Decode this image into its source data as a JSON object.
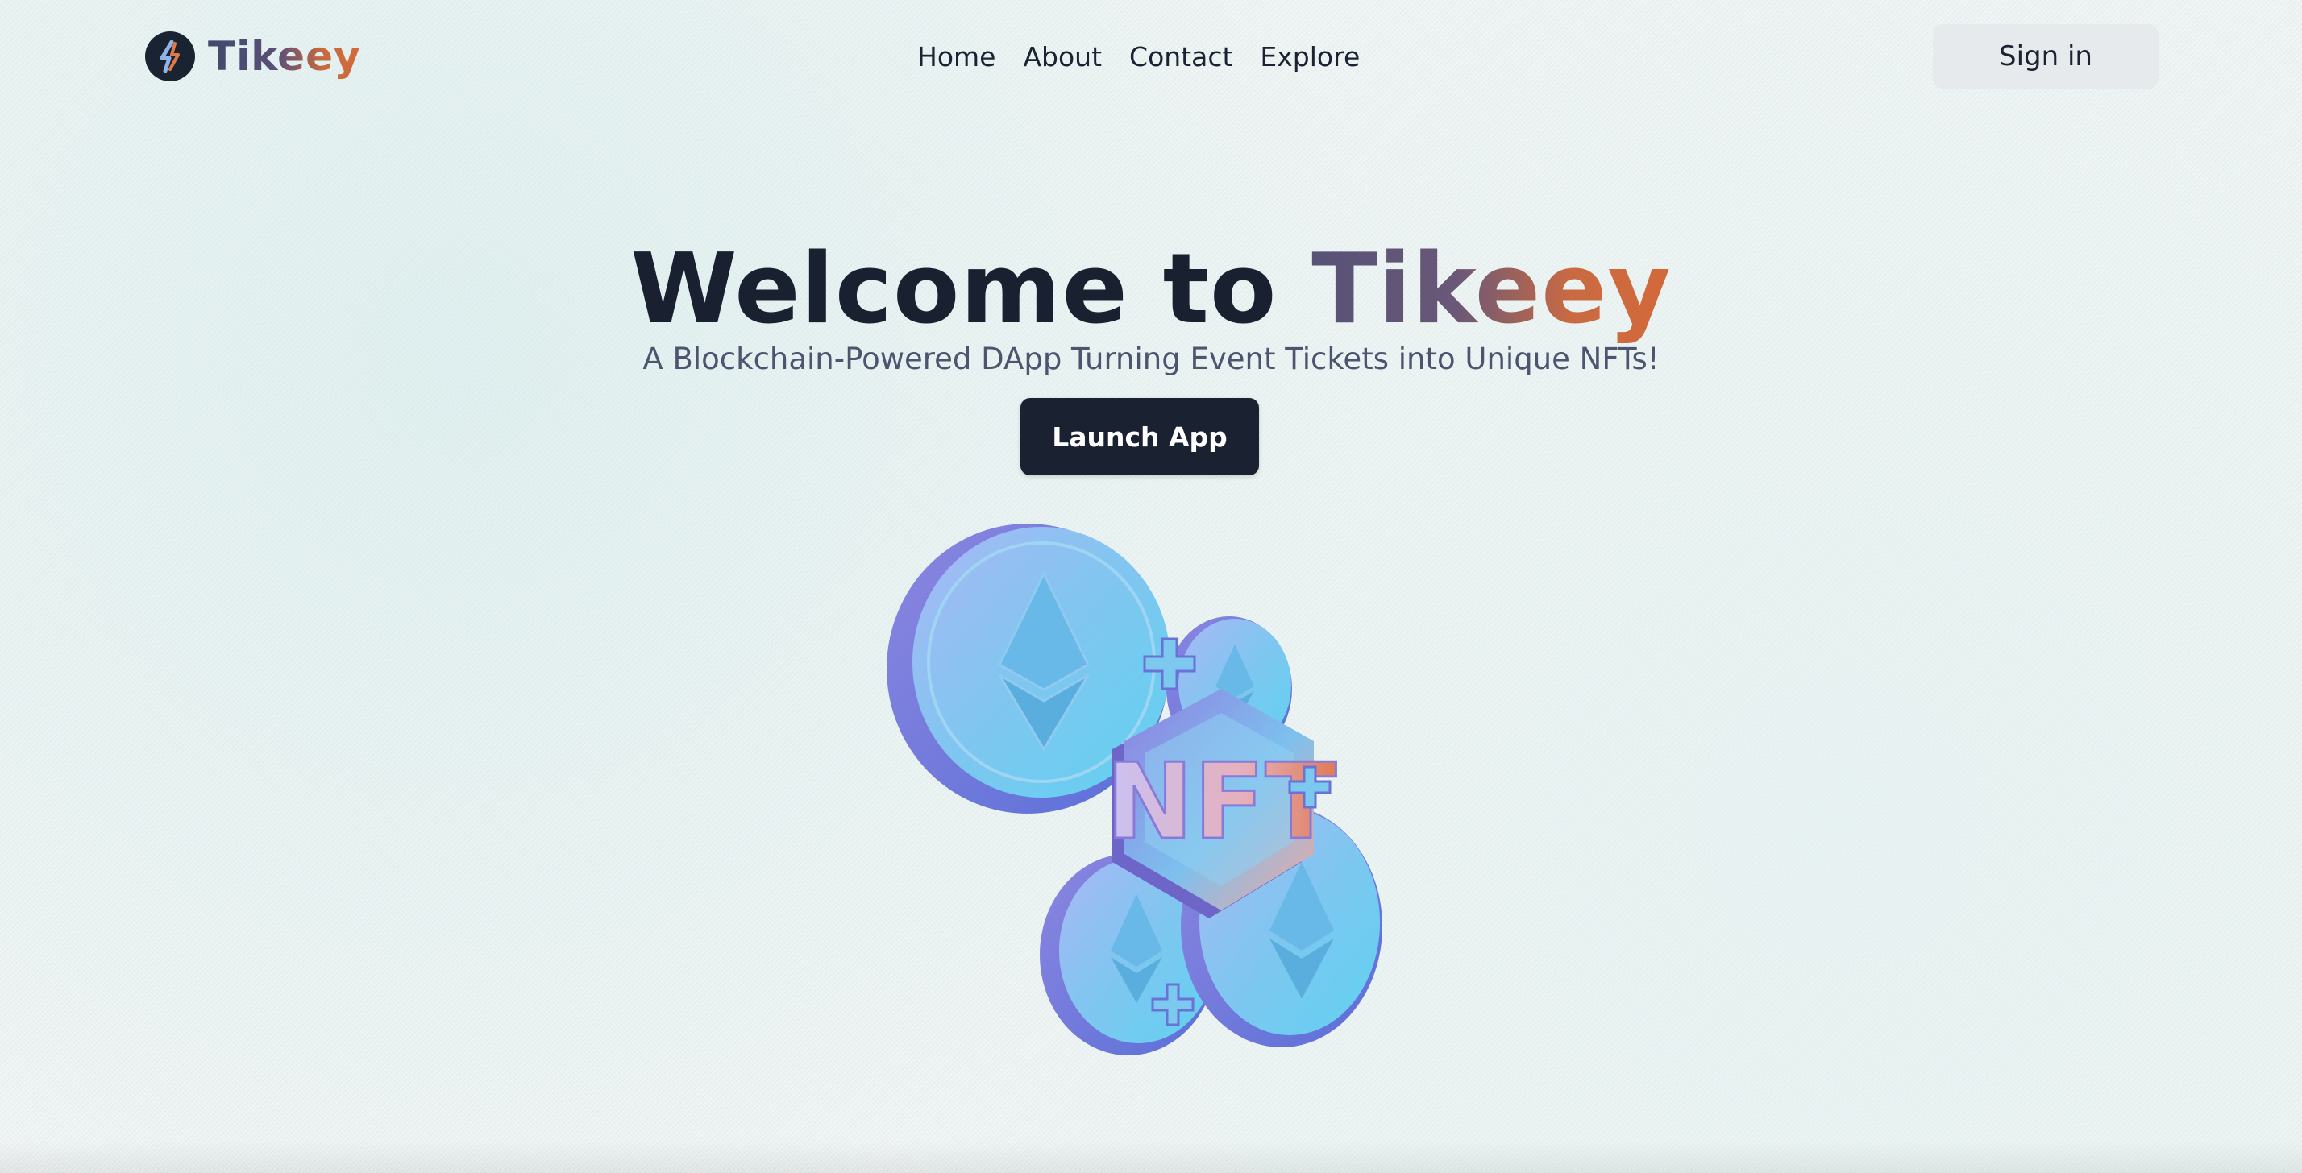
{
  "brand": {
    "name": "Tikeey",
    "logo_icon": "bolt-logo-icon"
  },
  "nav": {
    "links": [
      "Home",
      "About",
      "Contact",
      "Explore"
    ]
  },
  "header": {
    "signin_label": "Sign in"
  },
  "hero": {
    "title_prefix": "Welcome to ",
    "title_accent": "Tikeey",
    "subtitle": "A Blockchain-Powered DApp Turning Event Tickets into Unique NFTs!",
    "launch_label": "Launch App",
    "illustration_text": "NFT"
  },
  "colors": {
    "primary_dark": "#1a2130",
    "accent_start": "#565277",
    "accent_end": "#d3693a",
    "background": "#eef3f2",
    "coin_blue": "#6fc4ee"
  }
}
